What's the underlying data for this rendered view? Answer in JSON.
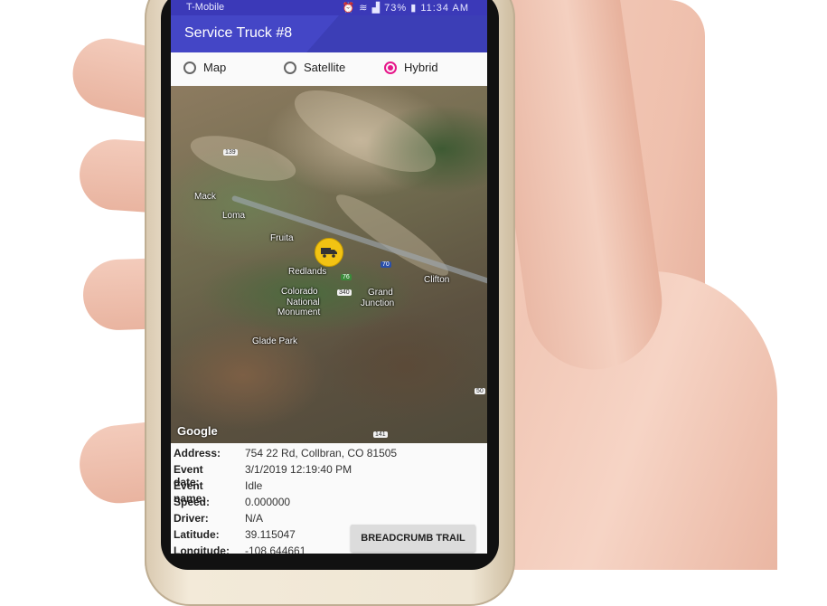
{
  "status_bar": {
    "carrier": "T-Mobile",
    "battery": "73%",
    "time": "11:34 AM"
  },
  "app_bar": {
    "title": "Service Truck #8"
  },
  "map_type": {
    "options": [
      {
        "label": "Map",
        "selected": false
      },
      {
        "label": "Satellite",
        "selected": false
      },
      {
        "label": "Hybrid",
        "selected": true
      }
    ]
  },
  "map": {
    "attribution": "Google",
    "places": [
      "Mack",
      "Loma",
      "Fruita",
      "Redlands",
      "Colorado",
      "National",
      "Monument",
      "Grand",
      "Junction",
      "Clifton",
      "Glade Park"
    ],
    "route_shields": [
      "139",
      "70",
      "76",
      "340",
      "50",
      "141"
    ],
    "marker_icon": "truck-icon"
  },
  "details": {
    "address_label": "Address:",
    "address": "754 22 Rd, Collbran, CO 81505",
    "event_date_label": "Event date:",
    "event_date": "3/1/2019 12:19:40 PM",
    "event_name_label": "Event name:",
    "event_name": "Idle",
    "speed_label": "Speed:",
    "speed": "0.000000",
    "driver_label": "Driver:",
    "driver": "N/A",
    "latitude_label": "Latitude:",
    "latitude": "39.115047",
    "longitude_label": "Longitude:",
    "longitude": "-108.644661"
  },
  "buttons": {
    "breadcrumb": "BREADCRUMB TRAIL"
  },
  "colors": {
    "appbar": "#4446c6",
    "accent": "#e6168a",
    "marker": "#f2c313"
  }
}
